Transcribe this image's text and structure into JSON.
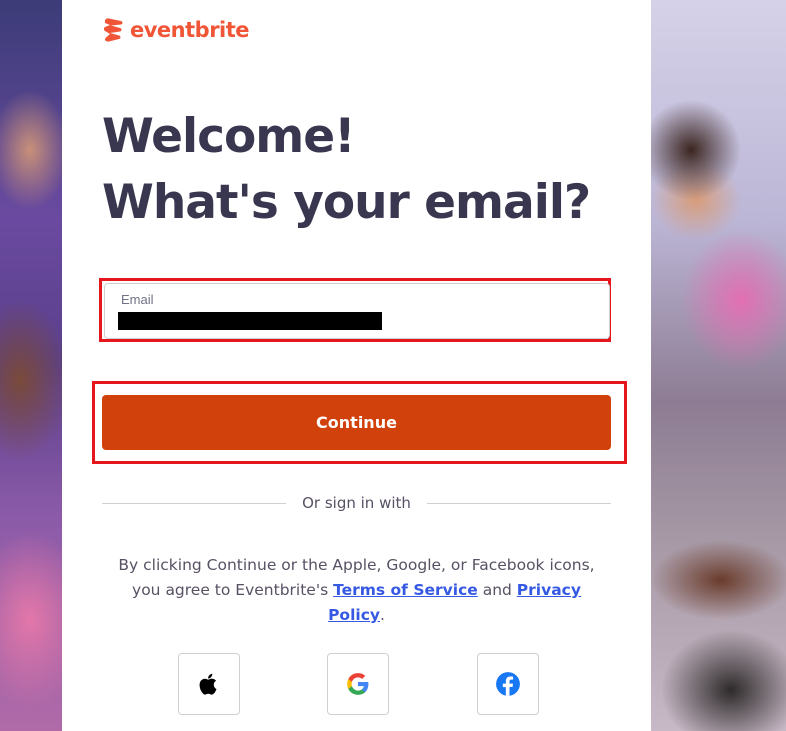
{
  "brand": {
    "name": "eventbrite",
    "color": "#f05537"
  },
  "heading": {
    "line1": "Welcome!",
    "line2": "What's your email?"
  },
  "email_field": {
    "label": "Email",
    "value": ""
  },
  "continue_button": {
    "label": "Continue",
    "color": "#d1410c"
  },
  "divider": {
    "label": "Or sign in with"
  },
  "legal": {
    "text_before": "By clicking Continue or the Apple, Google, or Facebook icons, you agree to Eventbrite's ",
    "terms_link": "Terms of Service",
    "text_middle": " and ",
    "privacy_link": "Privacy Policy",
    "text_after": "."
  },
  "social_buttons": [
    {
      "name": "Apple",
      "icon": "apple-icon"
    },
    {
      "name": "Google",
      "icon": "google-icon"
    },
    {
      "name": "Facebook",
      "icon": "facebook-icon"
    }
  ],
  "highlight_color": "#e5171d"
}
